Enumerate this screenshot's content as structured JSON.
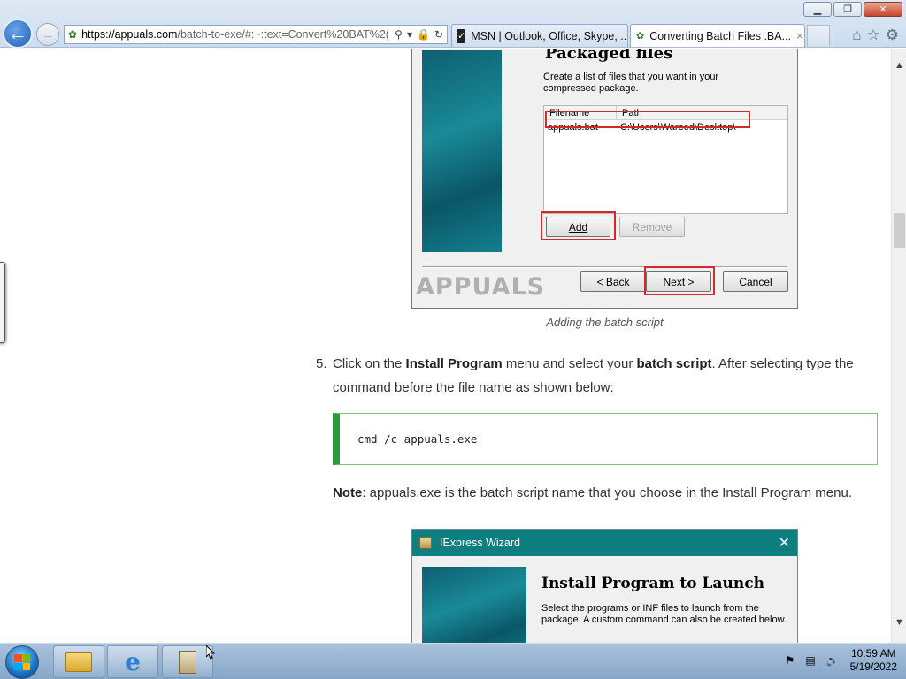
{
  "browser": {
    "address": {
      "domain": "https://appuals.com",
      "rest": "/batch-to-exe/#:~:text=Convert%20BAT%2(",
      "search_icon": "magnifier-icon",
      "lock_icon": "lock-icon",
      "refresh_icon": "refresh-icon"
    },
    "tabs": [
      {
        "label": "MSN | Outlook, Office, Skype, ...",
        "active": false
      },
      {
        "label": "Converting Batch Files .BA...",
        "active": true,
        "close": "×"
      }
    ],
    "window_controls": {
      "minimize": "▁",
      "maximize": "❐",
      "close": "✕"
    },
    "tools": {
      "home": "⌂",
      "favorites": "☆",
      "settings": "⚙"
    }
  },
  "wizard1": {
    "heading": "Packaged files",
    "description": "Create a list of files that you want in your compressed package.",
    "columns": [
      "Filename",
      "Path"
    ],
    "rows": [
      {
        "filename": "appuals.bat",
        "path": "C:\\Users\\Wareed\\Desktop\\"
      }
    ],
    "buttons": {
      "add": "Add",
      "remove": "Remove",
      "back": "< Back",
      "next": "Next >",
      "cancel": "Cancel"
    },
    "logo": "APPUALS"
  },
  "caption": "Adding the batch script",
  "step": {
    "number": "5.",
    "text_1": "Click on the ",
    "bold_1": "Install Program",
    "text_2": " menu and select your ",
    "bold_2": "batch script",
    "text_3": ". After selecting type the command before the file name as shown below:"
  },
  "code": "cmd /c appuals.exe",
  "note": {
    "label": "Note",
    "text": ": appuals.exe is the batch script name that you choose in the Install Program menu."
  },
  "wizard2": {
    "title": "IExpress Wizard",
    "close": "✕",
    "heading": "Install Program to Launch",
    "description": "Select the programs or INF files to launch from the package.  A custom command can also be created below."
  },
  "taskbar": {
    "time": "10:59 AM",
    "date": "5/19/2022"
  },
  "colors": {
    "accent_green": "#2a9a3a",
    "highlight_red": "#d12a2a",
    "wizard_teal": "#0e7f80"
  }
}
